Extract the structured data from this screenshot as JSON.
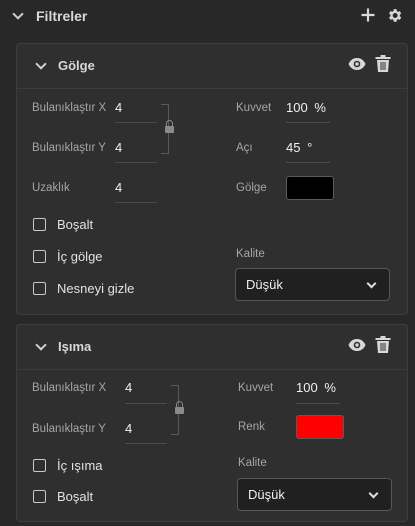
{
  "header": {
    "title": "Filtreler"
  },
  "shadow": {
    "title": "Gölge",
    "blur_x": {
      "label": "Bulanıklaştır X",
      "value": "4"
    },
    "blur_y": {
      "label": "Bulanıklaştır Y",
      "value": "4"
    },
    "distance": {
      "label": "Uzaklık",
      "value": "4"
    },
    "strength": {
      "label": "Kuvvet",
      "value": "100",
      "unit": "%"
    },
    "angle": {
      "label": "Açı",
      "value": "45",
      "unit": "°"
    },
    "color": {
      "label": "Gölge",
      "hex": "#000000"
    },
    "knockout": {
      "label": "Boşalt",
      "checked": false
    },
    "inner_shadow": {
      "label": "İç gölge",
      "checked": false
    },
    "hide_object": {
      "label": "Nesneyi gizle",
      "checked": false
    },
    "quality": {
      "label": "Kalite",
      "value": "Düşük"
    }
  },
  "glow": {
    "title": "Işıma",
    "blur_x": {
      "label": "Bulanıklaştır X",
      "value": "4"
    },
    "blur_y": {
      "label": "Bulanıklaştır Y",
      "value": "4"
    },
    "strength": {
      "label": "Kuvvet",
      "value": "100",
      "unit": "%"
    },
    "color": {
      "label": "Renk",
      "hex": "#ff0000"
    },
    "inner_glow": {
      "label": "İç ışıma",
      "checked": false
    },
    "knockout": {
      "label": "Boşalt",
      "checked": false
    },
    "quality": {
      "label": "Kalite",
      "value": "Düşük"
    }
  },
  "icons": [
    "chevron-down-icon",
    "plus-icon",
    "gear-icon",
    "eye-icon",
    "trash-icon",
    "lock-icon"
  ]
}
